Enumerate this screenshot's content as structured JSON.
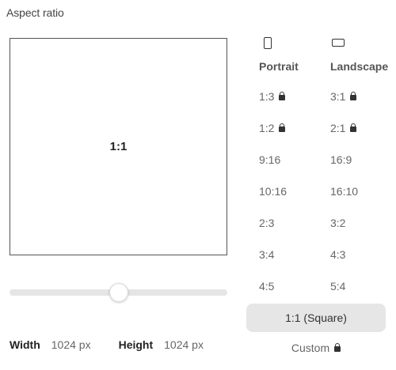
{
  "title": "Aspect ratio",
  "preview": {
    "label": "1:1"
  },
  "slider": {
    "value_fraction": 0.5
  },
  "dimensions": {
    "width_label": "Width",
    "width_value": "1024 px",
    "height_label": "Height",
    "height_value": "1024 px"
  },
  "portrait": {
    "header": "Portrait",
    "items": [
      {
        "label": "1:3",
        "locked": true
      },
      {
        "label": "1:2",
        "locked": true
      },
      {
        "label": "9:16",
        "locked": false
      },
      {
        "label": "10:16",
        "locked": false
      },
      {
        "label": "2:3",
        "locked": false
      },
      {
        "label": "3:4",
        "locked": false
      },
      {
        "label": "4:5",
        "locked": false
      }
    ]
  },
  "landscape": {
    "header": "Landscape",
    "items": [
      {
        "label": "3:1",
        "locked": true
      },
      {
        "label": "2:1",
        "locked": true
      },
      {
        "label": "16:9",
        "locked": false
      },
      {
        "label": "16:10",
        "locked": false
      },
      {
        "label": "3:2",
        "locked": false
      },
      {
        "label": "4:3",
        "locked": false
      },
      {
        "label": "5:4",
        "locked": false
      }
    ]
  },
  "square_button": {
    "label": "1:1 (Square)"
  },
  "custom": {
    "label": "Custom",
    "locked": true
  },
  "colors": {
    "selected_bg": "#e6e6e6",
    "slider_track": "#e5e5e5",
    "text": "#666666"
  }
}
